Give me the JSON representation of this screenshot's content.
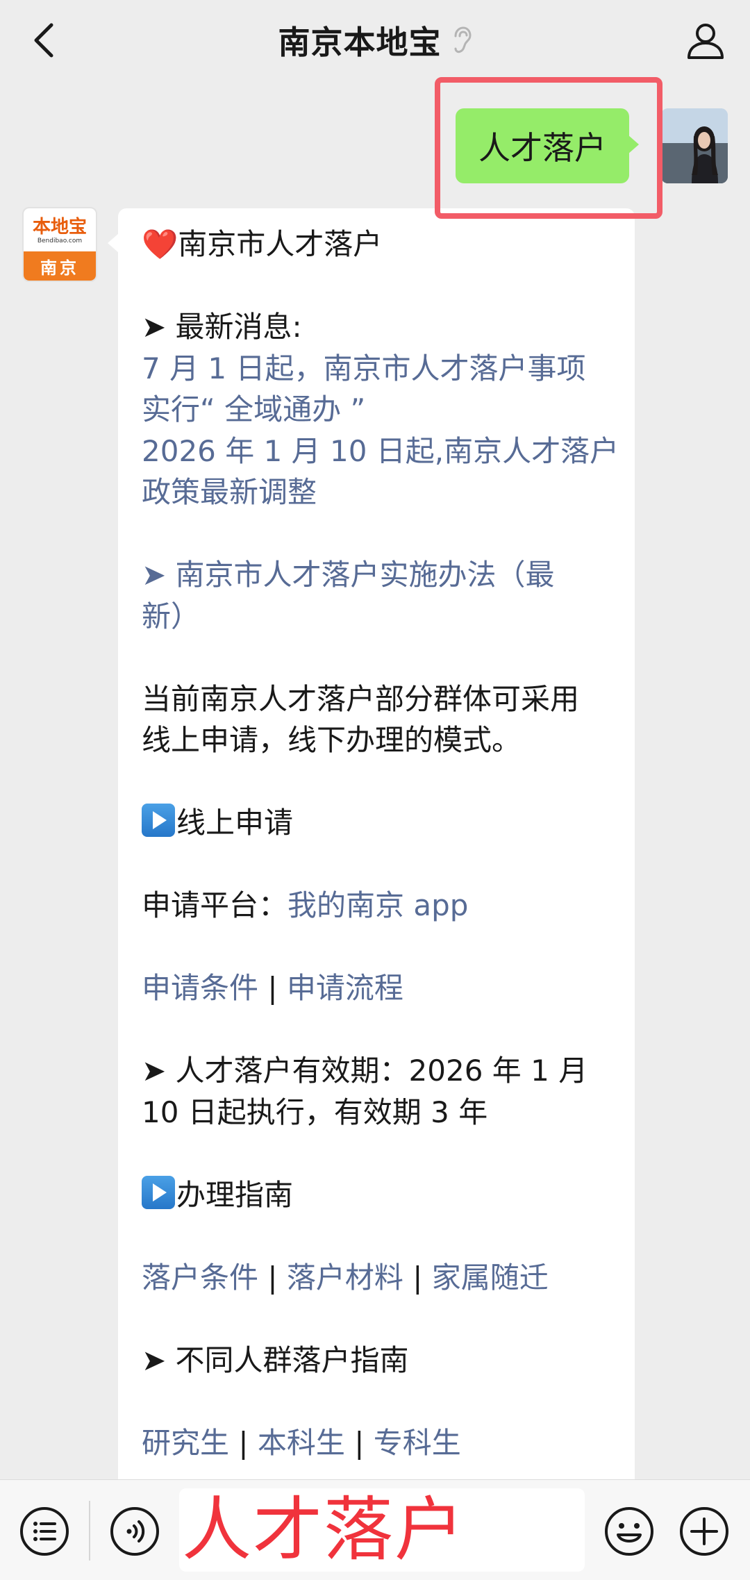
{
  "header": {
    "title": "南京本地宝",
    "back_icon": "chevron-left-icon",
    "title_badge_icon": "ear-icon",
    "profile_icon": "person-icon"
  },
  "chat": {
    "sent_message": "人才落户",
    "bot_avatar": {
      "brand": "本地宝",
      "domain": "Bendibao.com",
      "city": "南京"
    },
    "reply": {
      "heading": "南京市人才落户",
      "latest_label": "➤ 最新消息:",
      "latest_link1_line1": "7 月 1 日起，南京市人才落户事项",
      "latest_link1_line2": "实行“ 全域通办 ”",
      "latest_link2_line1": "2026 年 1 月 10 日起,南京人才落户",
      "latest_link2_line2": "政策最新调整",
      "method_link_line1": "➤ 南京市人才落户实施办法（最",
      "method_link_line2": "新）",
      "intro_line1": "当前南京人才落户部分群体可采用",
      "intro_line2": "线上申请，线下办理的模式。",
      "online_title": "线上申请",
      "platform_label": "申请平台：",
      "platform_link": "我的南京 app",
      "apply_conditions": "申请条件",
      "apply_process": "申请流程",
      "validity_line1": "➤ 人才落户有效期：2026 年 1 月",
      "validity_line2": "10 日起执行，有效期 3 年",
      "guide_title": "办理指南",
      "settle_conditions": "落户条件",
      "settle_materials": "落户材料",
      "family_move": "家属随迁",
      "groups_title": "➤ 不同人群落户指南",
      "postgrad": "研究生",
      "undergrad": "本科生",
      "junior_college": "专科生",
      "separator": "|"
    }
  },
  "input_bar": {
    "menu_icon": "menu-list-icon",
    "voice_icon": "voice-icon",
    "input_value": "人才落户",
    "emoji_icon": "emoji-icon",
    "plus_icon": "plus-icon"
  },
  "colors": {
    "sent_bubble": "#95ec69",
    "link": "#576b95",
    "highlight": "#f25c67",
    "input_text": "#f0333c"
  }
}
